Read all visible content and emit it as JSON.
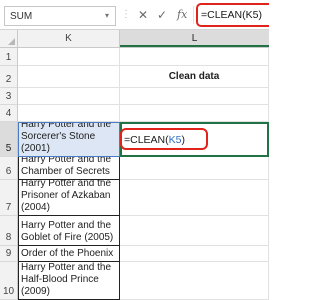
{
  "formula_bar": {
    "name_box": "SUM",
    "name_box_arrow": "▾",
    "separator_glyph": "⋮",
    "cancel_glyph": "✕",
    "enter_glyph": "✓",
    "fx_label": "fx",
    "formula": "=CLEAN(K5)"
  },
  "columns": {
    "k": "K",
    "l": "L"
  },
  "rows": {
    "r1": "1",
    "r2": "2",
    "r3": "3",
    "r4": "4",
    "r5": "5",
    "r6": "6",
    "r7": "7",
    "r8": "8",
    "r9": "9",
    "r10": "10"
  },
  "cells": {
    "l2": "Clean data",
    "k5": "Harry Potter and the Sorcerer's Stone (2001)",
    "k6": "Harry Potter and the Chamber of Secrets",
    "k7": "Harry Potter and the Prisoner of Azkaban (2004)",
    "k8": "Harry Potter and the Goblet of Fire (2005)",
    "k9": "Harry Potter and the Order of the Phoenix",
    "k10": "Harry Potter and the Half-Blood Prince (2009)"
  },
  "active_cell": {
    "prefix": "=CLEAN(",
    "ref": "K5",
    "suffix": ")"
  },
  "colors": {
    "accent_green": "#217346",
    "highlight_red": "#e0241b",
    "reference_blue": "#2e6fbf"
  }
}
